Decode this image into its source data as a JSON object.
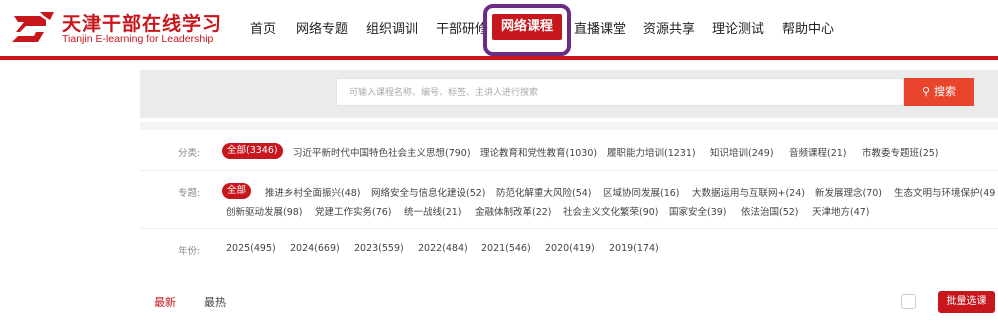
{
  "header": {
    "logo_cn": "天津干部在线学习",
    "logo_en": "Tianjin E-learning for Leadership",
    "nav": [
      "首页",
      "网络专题",
      "组织调训",
      "干部研修",
      "网络课程",
      "直播课堂",
      "资源共享",
      "理论测试",
      "帮助中心"
    ],
    "active_nav": "网络课程",
    "accent_color": "#c8161d",
    "highlight_color": "#6b2c88"
  },
  "search": {
    "placeholder": "可输入课程名称、编号、标签、主讲人进行搜索",
    "button_label": "搜索",
    "button_icon": "search-icon"
  },
  "filters": {
    "category": {
      "label": "分类:",
      "items": [
        "全部(3346)",
        "习近平新时代中国特色社会主义思想(790)",
        "理论教育和党性教育(1030)",
        "履职能力培训(1231)",
        "知识培训(249)",
        "音频课程(21)",
        "市教委专题班(25)"
      ]
    },
    "topic": {
      "label": "专题:",
      "items_row1": [
        "全部",
        "推进乡村全面振兴(48)",
        "网络安全与信息化建设(52)",
        "防范化解重大风险(54)",
        "区域协同发展(16)",
        "大数据运用与互联网+(24)",
        "新发展理念(70)",
        "生态文明与环境保护(49"
      ],
      "items_row2": [
        "创新驱动发展(98)",
        "党建工作实务(76)",
        "统一战线(21)",
        "金融体制改革(22)",
        "社会主义文化繁荣(90)",
        "国家安全(39)",
        "依法治国(52)",
        "天津地方(47)"
      ]
    },
    "year": {
      "label": "年份:",
      "items": [
        "2025(495)",
        "2024(669)",
        "2023(559)",
        "2022(484)",
        "2021(546)",
        "2020(419)",
        "2019(174)"
      ]
    }
  },
  "sort": {
    "newest": "最新",
    "hottest": "最热"
  },
  "batch_select": "批量选课"
}
